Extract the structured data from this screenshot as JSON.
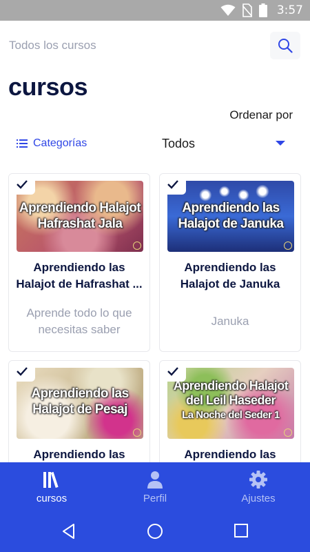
{
  "status_bar": {
    "time": "3:57",
    "icons": [
      "wifi-icon",
      "no-sim-icon",
      "battery-icon"
    ]
  },
  "header": {
    "all_courses": "Todos los cursos",
    "search_icon": "search-icon",
    "title": "cursos"
  },
  "sort": {
    "label": "Ordenar por"
  },
  "filters": {
    "categories_label": "Categorías",
    "categories_icon": "list-icon",
    "selected": "Todos"
  },
  "courses": [
    {
      "thumb_lines": [
        "Aprendiendo Halajot",
        "Hafrashat Jala"
      ],
      "title_lines": [
        "Aprendiendo las",
        "Halajot de Hafrashat ..."
      ],
      "desc_lines": [
        "Aprende todo lo que",
        "necesitas saber"
      ],
      "completed": true
    },
    {
      "thumb_lines": [
        "Aprendiendo las",
        "Halajot de Januka"
      ],
      "title_lines": [
        "Aprendiendo las",
        "Halajot de Januka"
      ],
      "desc_lines": [
        "Januka"
      ],
      "completed": true
    },
    {
      "thumb_lines": [
        "Aprendiendo las",
        "Halajot de Pesaj"
      ],
      "title_lines": [
        "Aprendiendo las"
      ],
      "desc_lines": [],
      "completed": true
    },
    {
      "thumb_lines": [
        "Aprendiendo Halajot",
        "del Leil Haseder",
        "La Noche del Seder 1"
      ],
      "title_lines": [
        "Aprendiendo las"
      ],
      "desc_lines": [],
      "completed": true
    }
  ],
  "bottom_nav": {
    "items": [
      {
        "label": "cursos",
        "icon": "books-icon",
        "active": true
      },
      {
        "label": "Perfil",
        "icon": "person-icon",
        "active": false
      },
      {
        "label": "Ajustes",
        "icon": "gear-icon",
        "active": false
      }
    ]
  },
  "system_nav": [
    "back-icon",
    "home-icon",
    "recents-icon"
  ],
  "colors": {
    "accent": "#2b4cde",
    "title": "#0c1640",
    "muted": "#9a9fb0",
    "status_bar": "#a9a9a9"
  }
}
